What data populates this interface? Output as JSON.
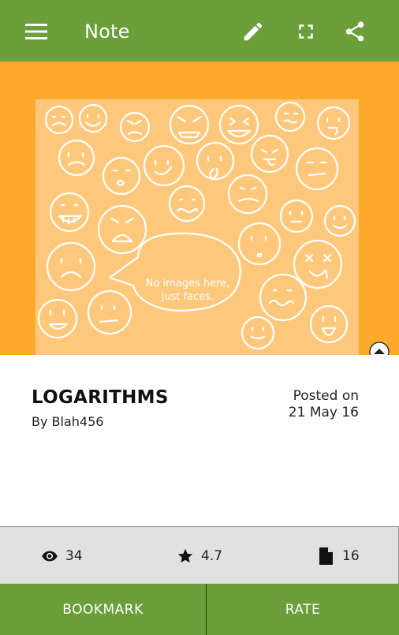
{
  "appbar": {
    "title": "Note",
    "menu_icon": "hamburger-menu-icon",
    "edit_icon": "pencil-icon",
    "fullscreen_icon": "fullscreen-icon",
    "share_icon": "share-icon",
    "color": "#6a9f39"
  },
  "hero": {
    "background": "#fdaa2c",
    "image_caption_line1": "No images here,",
    "image_caption_line2": "just faces.",
    "collapse_icon": "chevron-up-icon"
  },
  "note": {
    "title": "LOGARITHMS",
    "author": "By Blah456",
    "posted_label": "Posted on",
    "posted_date": "21 May 16"
  },
  "stats": {
    "views": "34",
    "rating": "4.7",
    "pages": "16",
    "views_icon": "eye-icon",
    "rating_icon": "star-icon",
    "pages_icon": "document-icon"
  },
  "actions": {
    "bookmark_label": "BOOKMARK",
    "rate_label": "RATE"
  }
}
